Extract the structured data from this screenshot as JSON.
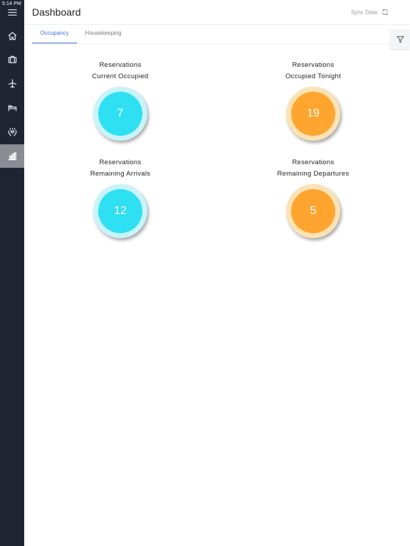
{
  "status_bar": {
    "time": "5:14 PM"
  },
  "sidebar": {
    "items": [
      {
        "icon": "menu-icon"
      },
      {
        "icon": "home-icon"
      },
      {
        "icon": "suitcase-icon"
      },
      {
        "icon": "airplane-icon"
      },
      {
        "icon": "bed-icon"
      },
      {
        "icon": "hands-heart-icon"
      },
      {
        "icon": "bar-chart-icon",
        "active": true
      }
    ]
  },
  "header": {
    "title": "Dashboard",
    "sync_label": "Sync Data"
  },
  "tabs": [
    {
      "label": "Occupancy",
      "active": true
    },
    {
      "label": "Housekeeping",
      "active": false
    }
  ],
  "widgets": [
    {
      "line1": "Reservations",
      "line2": "Current Occupied",
      "value": "7",
      "color": "#2ee0f2"
    },
    {
      "line1": "Reservations",
      "line2": "Occupied Tonight",
      "value": "19",
      "color": "#ffa52f"
    },
    {
      "line1": "Reservations",
      "line2": "Remaining Arrivals",
      "value": "12",
      "color": "#2ee0f2"
    },
    {
      "line1": "Reservations",
      "line2": "Remaining Departures",
      "value": "5",
      "color": "#ffa52f"
    }
  ],
  "colors": {
    "accent": "#3b74d9",
    "sidebar_bg": "#1f2532",
    "cyan": "#2ee0f2",
    "orange": "#ffa52f"
  }
}
